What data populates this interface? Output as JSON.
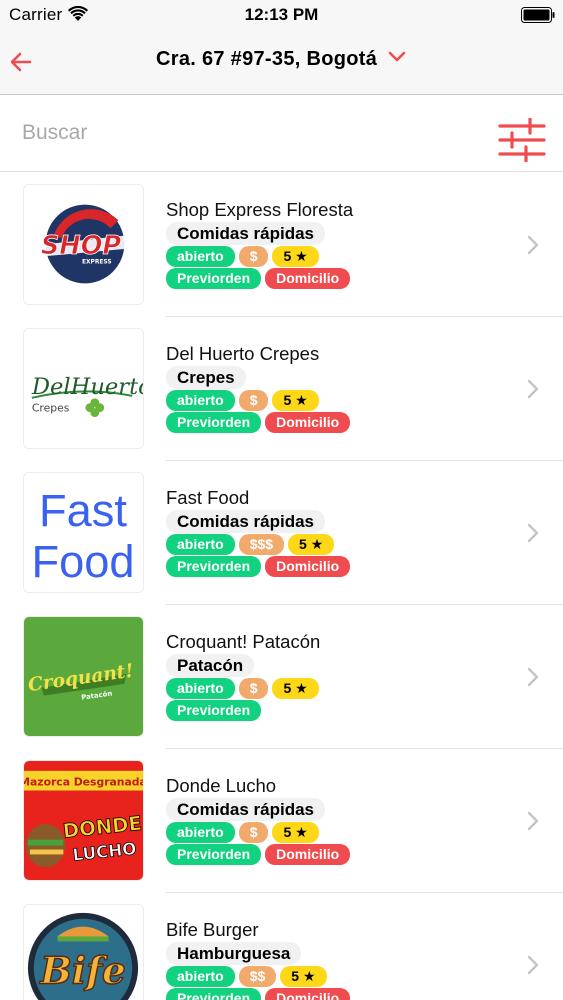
{
  "status_bar": {
    "carrier": "Carrier",
    "time": "12:13 PM"
  },
  "header": {
    "address": "Cra. 67 #97-35, Bogotá"
  },
  "search": {
    "placeholder": "Buscar"
  },
  "colors": {
    "accent": "#f04c50",
    "open": "#12d27f",
    "price": "#f0ab6c",
    "rating": "#ffd719"
  },
  "restaurants": [
    {
      "name": "Shop Express Floresta",
      "category": "Comidas rápidas",
      "status": "abierto",
      "price": "$",
      "rating": "5 ★",
      "preorder": "Previorden",
      "delivery": "Domicilio"
    },
    {
      "name": "Del Huerto Crepes",
      "category": "Crepes",
      "status": "abierto",
      "price": "$",
      "rating": "5 ★",
      "preorder": "Previorden",
      "delivery": "Domicilio"
    },
    {
      "name": "Fast Food",
      "category": "Comidas rápidas",
      "status": "abierto",
      "price": "$$$",
      "rating": "5 ★",
      "preorder": "Previorden",
      "delivery": "Domicilio"
    },
    {
      "name": "Croquant! Patacón",
      "category": "Patacón",
      "status": "abierto",
      "price": "$",
      "rating": "5 ★",
      "preorder": "Previorden"
    },
    {
      "name": "Donde Lucho",
      "category": "Comidas rápidas",
      "status": "abierto",
      "price": "$",
      "rating": "5 ★",
      "preorder": "Previorden",
      "delivery": "Domicilio"
    },
    {
      "name": "Bife Burger",
      "category": "Hamburguesa",
      "status": "abierto",
      "price": "$$",
      "rating": "5 ★",
      "preorder": "Previorden",
      "delivery": "Domicilio"
    }
  ],
  "logos": {
    "shop": {
      "main": "SHOP",
      "sub": "EXPRESS"
    },
    "huerto": {
      "main": "DelHuerto",
      "sub": "Crepes"
    },
    "fastfood": {
      "line1": "Fast",
      "line2": "Food"
    },
    "croquant": {
      "main": "Croquant!",
      "sub": "Patacón"
    },
    "lucho": {
      "banner": "Mazorca Desgranada",
      "line1": "DONDE",
      "line2": "LUCHO"
    },
    "bife": {
      "main": "Bife"
    }
  }
}
